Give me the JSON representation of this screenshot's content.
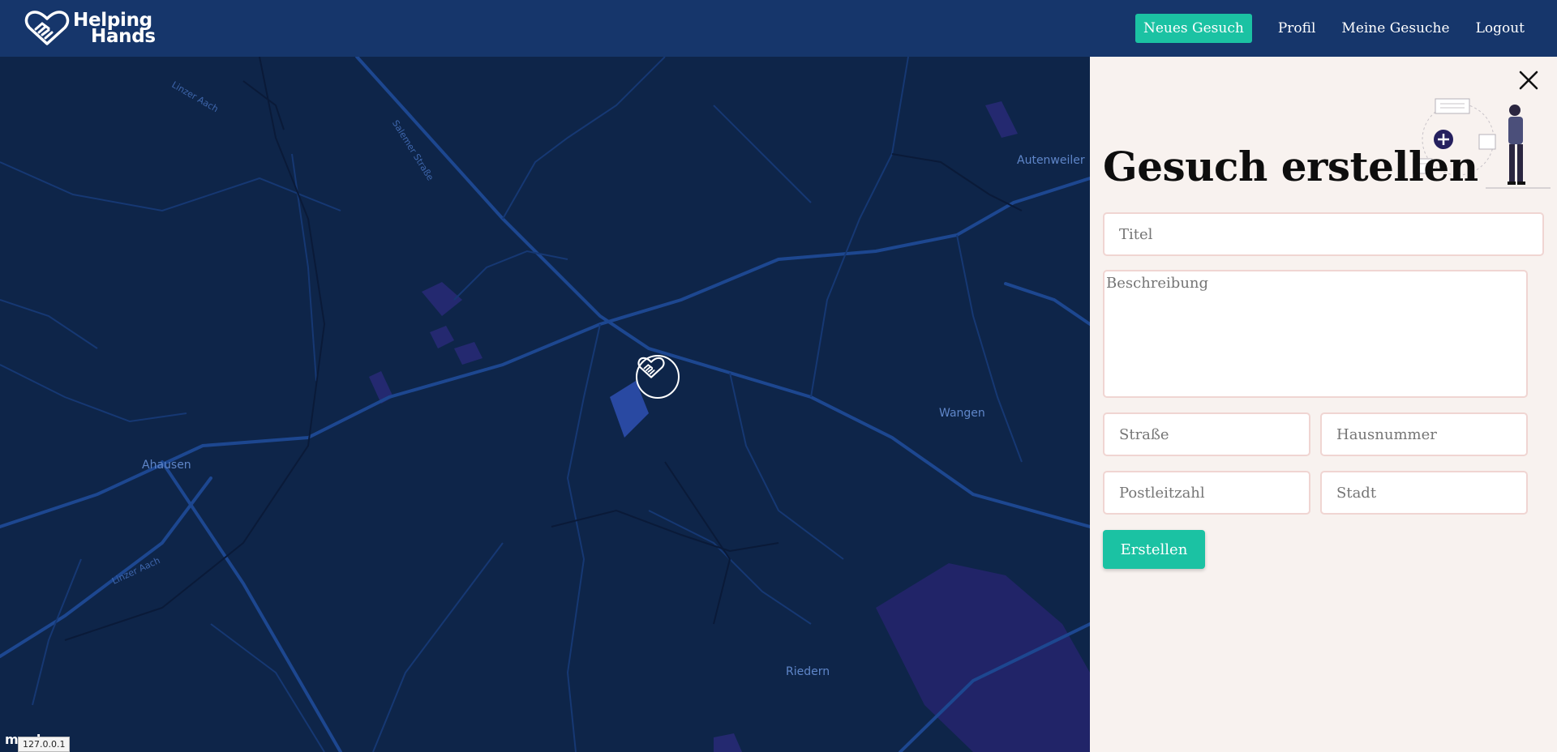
{
  "brand": {
    "line1": "Helping",
    "line2": "Hands"
  },
  "nav": {
    "new_request": "Neues Gesuch",
    "profile": "Profil",
    "my_requests": "Meine Gesuche",
    "logout": "Logout"
  },
  "map": {
    "places": {
      "autenweiler": "Autenweiler",
      "wangen": "Wangen",
      "ahausen": "Ahausen",
      "riedern": "Riedern"
    },
    "streets": {
      "salemer": "Salemer Straße",
      "linzer_top": "Linzer Aach",
      "linzer_bottom": "Linzer Aach"
    },
    "attribution_logo": "mapbox",
    "ip_badge": "127.0.0.1"
  },
  "form": {
    "title": "Gesuch erstellen",
    "titel_placeholder": "Titel",
    "beschreibung_placeholder": "Beschreibung",
    "strasse_placeholder": "Straße",
    "hausnummer_placeholder": "Hausnummer",
    "plz_placeholder": "Postleitzahl",
    "stadt_placeholder": "Stadt",
    "submit_label": "Erstellen"
  },
  "colors": {
    "navbar": "#16366b",
    "accent": "#1bc2a3",
    "map_bg": "#0e2549",
    "panel_bg": "#f8f2ef"
  },
  "icons": {
    "logo": "handshake-heart-icon",
    "marker": "handshake-icon",
    "close": "close-icon"
  }
}
